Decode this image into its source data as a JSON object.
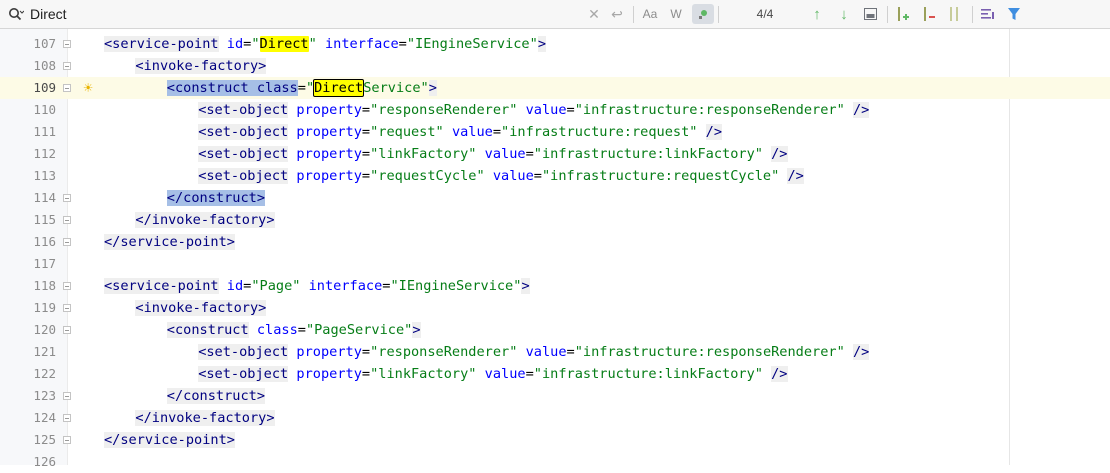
{
  "search": {
    "query": "Direct",
    "match_counter": "4/4",
    "option_case_label": "Aa",
    "option_word_label": "W",
    "icons": [
      "search-icon",
      "clear-icon",
      "newline-icon",
      "match-case-icon",
      "whole-word-icon",
      "regex-icon",
      "previous-occurrence-icon",
      "next-occurrence-icon",
      "select-all-occurrences-icon",
      "add-occurrence-icon",
      "remove-occurrence-icon",
      "select-all-carets-icon",
      "filter-options-icon",
      "filter-icon"
    ]
  },
  "editor": {
    "current_line": "109",
    "lines": [
      {
        "num": "107",
        "indent": 0,
        "parts": [
          {
            "c": "tg",
            "t": "<service-point"
          },
          {
            "c": "pl",
            "t": " "
          },
          {
            "c": "at",
            "t": "id"
          },
          {
            "c": "pl",
            "t": "="
          },
          {
            "c": "vl",
            "t": "\""
          },
          {
            "c": "hl",
            "t": "Direct"
          },
          {
            "c": "vl",
            "t": "\""
          },
          {
            "c": "pl",
            "t": " "
          },
          {
            "c": "at",
            "t": "interface"
          },
          {
            "c": "pl",
            "t": "="
          },
          {
            "c": "vl",
            "t": "\"IEngineService\""
          },
          {
            "c": "tg",
            "t": ">"
          }
        ]
      },
      {
        "num": "108",
        "indent": 1,
        "parts": [
          {
            "c": "tg",
            "t": "<invoke-factory>"
          }
        ]
      },
      {
        "num": "109",
        "indent": 2,
        "bulb": true,
        "parts": [
          {
            "c": "sel",
            "t": "<construct class"
          },
          {
            "c": "pl",
            "t": "="
          },
          {
            "c": "vl",
            "t": "\""
          },
          {
            "c": "hlb",
            "t": "Direct"
          },
          {
            "c": "vl",
            "t": "Service\""
          },
          {
            "c": "tg",
            "t": ">"
          }
        ]
      },
      {
        "num": "110",
        "indent": 3,
        "parts": [
          {
            "c": "tg",
            "t": "<set-object"
          },
          {
            "c": "pl",
            "t": " "
          },
          {
            "c": "at",
            "t": "property"
          },
          {
            "c": "pl",
            "t": "="
          },
          {
            "c": "vl",
            "t": "\"responseRenderer\""
          },
          {
            "c": "pl",
            "t": " "
          },
          {
            "c": "at",
            "t": "value"
          },
          {
            "c": "pl",
            "t": "="
          },
          {
            "c": "vl",
            "t": "\"infrastructure:responseRenderer\""
          },
          {
            "c": "pl",
            "t": " "
          },
          {
            "c": "tg",
            "t": "/>"
          }
        ]
      },
      {
        "num": "111",
        "indent": 3,
        "parts": [
          {
            "c": "tg",
            "t": "<set-object"
          },
          {
            "c": "pl",
            "t": " "
          },
          {
            "c": "at",
            "t": "property"
          },
          {
            "c": "pl",
            "t": "="
          },
          {
            "c": "vl",
            "t": "\"request\""
          },
          {
            "c": "pl",
            "t": " "
          },
          {
            "c": "at",
            "t": "value"
          },
          {
            "c": "pl",
            "t": "="
          },
          {
            "c": "vl",
            "t": "\"infrastructure:request\""
          },
          {
            "c": "pl",
            "t": " "
          },
          {
            "c": "tg",
            "t": "/>"
          }
        ]
      },
      {
        "num": "112",
        "indent": 3,
        "parts": [
          {
            "c": "tg",
            "t": "<set-object"
          },
          {
            "c": "pl",
            "t": " "
          },
          {
            "c": "at",
            "t": "property"
          },
          {
            "c": "pl",
            "t": "="
          },
          {
            "c": "vl",
            "t": "\"linkFactory\""
          },
          {
            "c": "pl",
            "t": " "
          },
          {
            "c": "at",
            "t": "value"
          },
          {
            "c": "pl",
            "t": "="
          },
          {
            "c": "vl",
            "t": "\"infrastructure:linkFactory\""
          },
          {
            "c": "pl",
            "t": " "
          },
          {
            "c": "tg",
            "t": "/>"
          }
        ]
      },
      {
        "num": "113",
        "indent": 3,
        "parts": [
          {
            "c": "tg",
            "t": "<set-object"
          },
          {
            "c": "pl",
            "t": " "
          },
          {
            "c": "at",
            "t": "property"
          },
          {
            "c": "pl",
            "t": "="
          },
          {
            "c": "vl",
            "t": "\"requestCycle\""
          },
          {
            "c": "pl",
            "t": " "
          },
          {
            "c": "at",
            "t": "value"
          },
          {
            "c": "pl",
            "t": "="
          },
          {
            "c": "vl",
            "t": "\"infrastructure:requestCycle\""
          },
          {
            "c": "pl",
            "t": " "
          },
          {
            "c": "tg",
            "t": "/>"
          }
        ]
      },
      {
        "num": "114",
        "indent": 2,
        "parts": [
          {
            "c": "sel",
            "t": "</construct>"
          }
        ]
      },
      {
        "num": "115",
        "indent": 1,
        "parts": [
          {
            "c": "tg",
            "t": "</invoke-factory>"
          }
        ]
      },
      {
        "num": "116",
        "indent": 0,
        "parts": [
          {
            "c": "tg",
            "t": "</service-point>"
          }
        ]
      },
      {
        "num": "117",
        "indent": 0,
        "parts": []
      },
      {
        "num": "118",
        "indent": 0,
        "parts": [
          {
            "c": "tg",
            "t": "<service-point"
          },
          {
            "c": "pl",
            "t": " "
          },
          {
            "c": "at",
            "t": "id"
          },
          {
            "c": "pl",
            "t": "="
          },
          {
            "c": "vl",
            "t": "\"Page\""
          },
          {
            "c": "pl",
            "t": " "
          },
          {
            "c": "at",
            "t": "interface"
          },
          {
            "c": "pl",
            "t": "="
          },
          {
            "c": "vl",
            "t": "\"IEngineService\""
          },
          {
            "c": "tg",
            "t": ">"
          }
        ]
      },
      {
        "num": "119",
        "indent": 1,
        "parts": [
          {
            "c": "tg",
            "t": "<invoke-factory>"
          }
        ]
      },
      {
        "num": "120",
        "indent": 2,
        "parts": [
          {
            "c": "tg",
            "t": "<construct"
          },
          {
            "c": "pl",
            "t": " "
          },
          {
            "c": "at",
            "t": "class"
          },
          {
            "c": "pl",
            "t": "="
          },
          {
            "c": "vl",
            "t": "\"PageService\""
          },
          {
            "c": "tg",
            "t": ">"
          }
        ]
      },
      {
        "num": "121",
        "indent": 3,
        "parts": [
          {
            "c": "tg",
            "t": "<set-object"
          },
          {
            "c": "pl",
            "t": " "
          },
          {
            "c": "at",
            "t": "property"
          },
          {
            "c": "pl",
            "t": "="
          },
          {
            "c": "vl",
            "t": "\"responseRenderer\""
          },
          {
            "c": "pl",
            "t": " "
          },
          {
            "c": "at",
            "t": "value"
          },
          {
            "c": "pl",
            "t": "="
          },
          {
            "c": "vl",
            "t": "\"infrastructure:responseRenderer\""
          },
          {
            "c": "pl",
            "t": " "
          },
          {
            "c": "tg",
            "t": "/>"
          }
        ]
      },
      {
        "num": "122",
        "indent": 3,
        "parts": [
          {
            "c": "tg",
            "t": "<set-object"
          },
          {
            "c": "pl",
            "t": " "
          },
          {
            "c": "at",
            "t": "property"
          },
          {
            "c": "pl",
            "t": "="
          },
          {
            "c": "vl",
            "t": "\"linkFactory\""
          },
          {
            "c": "pl",
            "t": " "
          },
          {
            "c": "at",
            "t": "value"
          },
          {
            "c": "pl",
            "t": "="
          },
          {
            "c": "vl",
            "t": "\"infrastructure:linkFactory\""
          },
          {
            "c": "pl",
            "t": " "
          },
          {
            "c": "tg",
            "t": "/>"
          }
        ]
      },
      {
        "num": "123",
        "indent": 2,
        "parts": [
          {
            "c": "tg",
            "t": "</construct>"
          }
        ]
      },
      {
        "num": "124",
        "indent": 1,
        "parts": [
          {
            "c": "tg",
            "t": "</invoke-factory>"
          }
        ]
      },
      {
        "num": "125",
        "indent": 0,
        "parts": [
          {
            "c": "tg",
            "t": "</service-point>"
          }
        ]
      },
      {
        "num": "126",
        "indent": 0,
        "parts": []
      }
    ]
  },
  "colors": {
    "tag": "#000080",
    "attribute": "#0000ff",
    "value": "#067d17",
    "search_highlight": "#ffff00",
    "selection": "#a6bfe6",
    "current_line": "#fdfbe6"
  }
}
